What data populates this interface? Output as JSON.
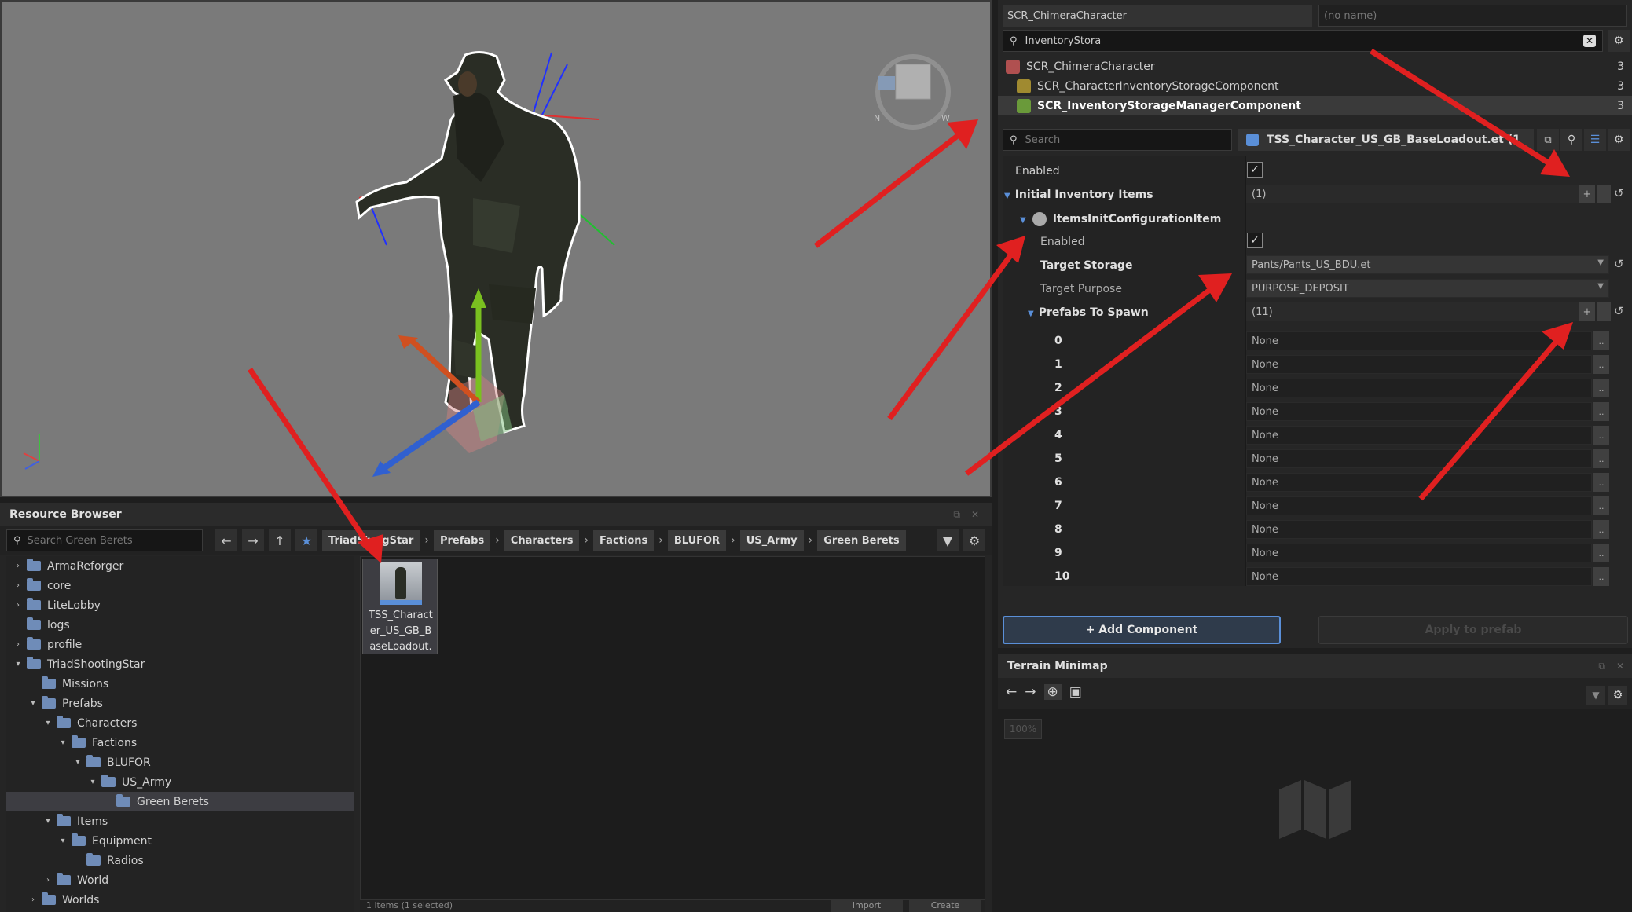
{
  "resource_browser": {
    "title": "Resource Browser",
    "search_placeholder": "Search Green Berets",
    "breadcrumb": [
      "TriadSh",
      "ngStar",
      "Prefabs",
      "Characters",
      "Factions",
      "BLUFOR",
      "US_Army",
      "Green Berets"
    ],
    "tree": [
      {
        "label": "ArmaReforger",
        "depth": 0,
        "arrow": "›"
      },
      {
        "label": "core",
        "depth": 0,
        "arrow": "›"
      },
      {
        "label": "LiteLobby",
        "depth": 0,
        "arrow": "›"
      },
      {
        "label": "logs",
        "depth": 0,
        "arrow": ""
      },
      {
        "label": "profile",
        "depth": 0,
        "arrow": "›"
      },
      {
        "label": "TriadShootingStar",
        "depth": 0,
        "arrow": "▾"
      },
      {
        "label": "Missions",
        "depth": 1,
        "arrow": ""
      },
      {
        "label": "Prefabs",
        "depth": 1,
        "arrow": "▾"
      },
      {
        "label": "Characters",
        "depth": 2,
        "arrow": "▾"
      },
      {
        "label": "Factions",
        "depth": 3,
        "arrow": "▾"
      },
      {
        "label": "BLUFOR",
        "depth": 4,
        "arrow": "▾"
      },
      {
        "label": "US_Army",
        "depth": 5,
        "arrow": "▾"
      },
      {
        "label": "Green Berets",
        "depth": 6,
        "arrow": "",
        "selected": true
      },
      {
        "label": "Items",
        "depth": 2,
        "arrow": "▾"
      },
      {
        "label": "Equipment",
        "depth": 3,
        "arrow": "▾"
      },
      {
        "label": "Radios",
        "depth": 4,
        "arrow": ""
      },
      {
        "label": "World",
        "depth": 2,
        "arrow": "›"
      },
      {
        "label": "Worlds",
        "depth": 1,
        "arrow": "›"
      }
    ],
    "asset": {
      "name": "TSS_Charact er_US_GB_B aseLoadout."
    },
    "status": "1 items (1 selected)",
    "import_label": "Import",
    "create_label": "Create"
  },
  "header": {
    "class_name": "SCR_ChimeraCharacter",
    "entity_name": "(no name)"
  },
  "component_search": {
    "value": "InventoryStora"
  },
  "components": [
    {
      "label": "SCR_ChimeraCharacter",
      "count": "3",
      "bold": false
    },
    {
      "label": "SCR_CharacterInventoryStorageComponent",
      "count": "3",
      "bold": false
    },
    {
      "label": "SCR_InventoryStorageManagerComponent",
      "count": "3",
      "bold": true
    }
  ],
  "properties": {
    "search_placeholder": "Search",
    "prefab_name": "TSS_Character_US_GB_BaseLoadout.et (1",
    "enabled_label": "Enabled",
    "initial_items_label": "Initial Inventory Items",
    "initial_items_count": "(1)",
    "item_config_label": "ItemsInitConfigurationItem",
    "item_enabled_label": "Enabled",
    "target_storage_label": "Target Storage",
    "target_storage_value": "Pants/Pants_US_BDU.et",
    "target_purpose_label": "Target Purpose",
    "target_purpose_value": "PURPOSE_DEPOSIT",
    "prefabs_label": "Prefabs To Spawn",
    "prefabs_count": "(11)",
    "prefab_slots": [
      {
        "index": "0",
        "value": "None"
      },
      {
        "index": "1",
        "value": "None"
      },
      {
        "index": "2",
        "value": "None"
      },
      {
        "index": "3",
        "value": "None"
      },
      {
        "index": "4",
        "value": "None"
      },
      {
        "index": "5",
        "value": "None"
      },
      {
        "index": "6",
        "value": "None"
      },
      {
        "index": "7",
        "value": "None"
      },
      {
        "index": "8",
        "value": "None"
      },
      {
        "index": "9",
        "value": "None"
      },
      {
        "index": "10",
        "value": "None"
      }
    ],
    "add_component_label": "+ Add Component",
    "apply_label": "Apply to prefab"
  },
  "minimap": {
    "title": "Terrain Minimap",
    "zoom": "100%"
  },
  "colors": {
    "accent": "#5a8fd8",
    "arrow": "#e02020"
  }
}
